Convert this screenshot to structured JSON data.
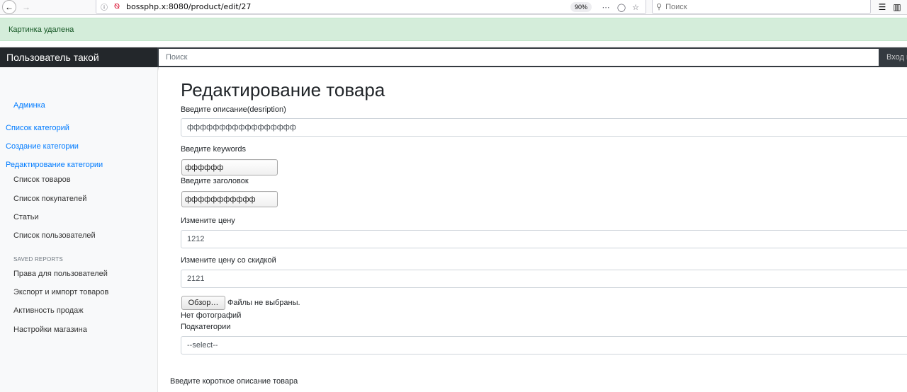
{
  "browser": {
    "url": "bossphp.x:8080/product/edit/27",
    "zoom": "90%",
    "search_placeholder": "Поиск"
  },
  "flash": {
    "message": "Картинка удалена"
  },
  "navbar": {
    "brand": "Пользователь такой",
    "search_placeholder": "Поиск",
    "login": "Вход в"
  },
  "sidebar": {
    "admin_link": "Админка",
    "category_links": [
      "Список категорий",
      "Создание категории",
      "Редактирование категории"
    ],
    "items": [
      "Список товаров",
      "Список покупателей",
      "Статьи",
      "Список пользователей"
    ],
    "saved_reports_heading": "SAVED REPORTS",
    "report_items": [
      "Права для пользователей",
      "Экспорт и импорт товаров",
      "Активность продаж",
      "Настройки магазина"
    ]
  },
  "form": {
    "title": "Редактирование товара",
    "description_label": "Введите описание(desription)",
    "description_value": "ффффффффффффффффф",
    "keywords_label": "Введите keywords",
    "keywords_value": "фффффф",
    "heading_label": "Введите заголовок",
    "heading_value": "ффффффффффф",
    "price_label": "Измените цену",
    "price_value": "1212",
    "discount_label": "Измените цену со скидкой",
    "discount_value": "2121",
    "browse_button": "Обзор…",
    "file_status": "Файлы не выбраны.",
    "no_photos": "Нет фотографий",
    "subcategory_label": "Подкатегории",
    "subcategory_selected": "--select--",
    "short_description_label": "Введите короткое описание товара"
  },
  "colors": {
    "flash_bg": "#d4edda",
    "navbar_bg": "#343a40",
    "brand_bg": "#23272b",
    "link": "#007bff"
  }
}
